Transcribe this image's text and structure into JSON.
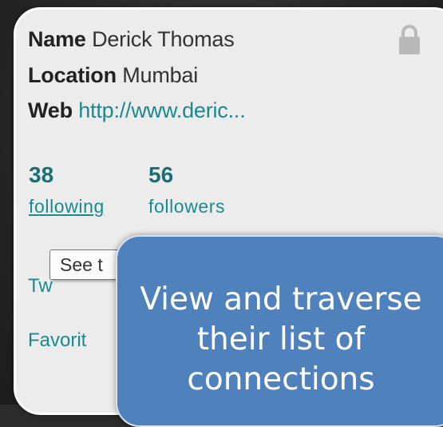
{
  "profile": {
    "name_label": "Name",
    "name_value": "Derick Thomas",
    "location_label": "Location",
    "location_value": "Mumbai",
    "web_label": "Web",
    "web_value": "http://www.deric..."
  },
  "stats": {
    "following_count": "38",
    "following_label": "following",
    "followers_count": "56",
    "followers_label": "followers"
  },
  "links": {
    "tweets_partial": "Tw",
    "favorites_partial": "Favorit"
  },
  "tooltip": {
    "text": "See t"
  },
  "callout": {
    "text": "View and traverse their list of connections"
  },
  "colors": {
    "link": "#1a8a8f",
    "count": "#1a6f73",
    "callout_bg": "#4f81bd",
    "card_bg": "#ececec"
  },
  "icons": {
    "lock": "lock-icon"
  }
}
